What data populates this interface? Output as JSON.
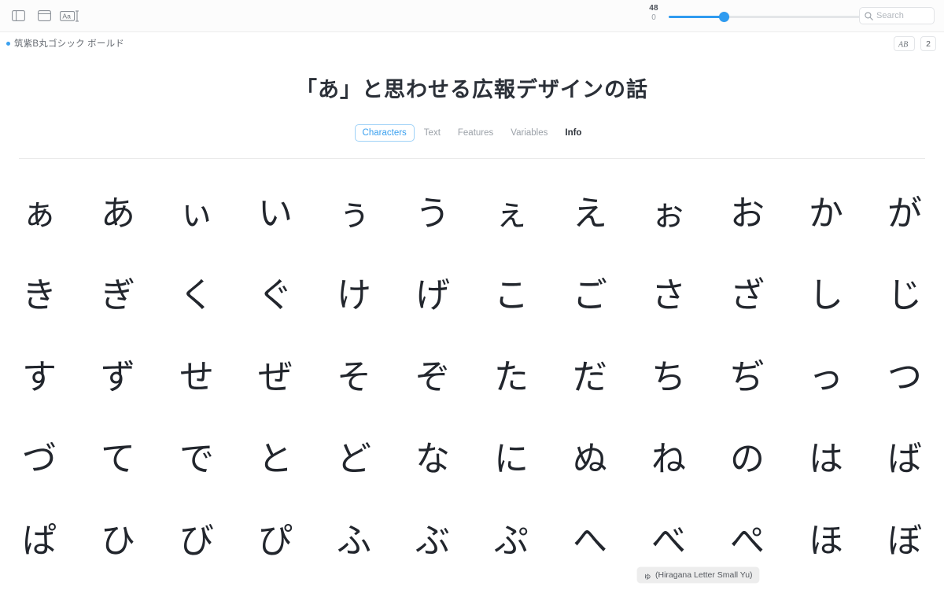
{
  "toolbar": {
    "icons": [
      {
        "name": "sidebar-toggle-icon",
        "label": "Sidebar"
      },
      {
        "name": "panel-toggle-icon",
        "label": "Panel"
      },
      {
        "name": "text-tool-icon",
        "label": "Aa"
      }
    ],
    "size_slider": {
      "value": "48",
      "min": "0",
      "fill_percent": 28
    },
    "search": {
      "placeholder": "Search",
      "value": "",
      "icon": "search-icon"
    }
  },
  "fontbar": {
    "status_dot_color": "#3aa0ef",
    "font_name": "筑紫B丸ゴシック ボールド",
    "ligature_chip": "AB",
    "count_chip": "2"
  },
  "specimen": {
    "title": "「あ」と思わせる広報デザインの話"
  },
  "tabs": [
    {
      "label": "Characters",
      "state": "selected"
    },
    {
      "label": "Text",
      "state": "normal"
    },
    {
      "label": "Features",
      "state": "normal"
    },
    {
      "label": "Variables",
      "state": "normal"
    },
    {
      "label": "Info",
      "state": "strong"
    }
  ],
  "glyphs": [
    "ぁ",
    "あ",
    "ぃ",
    "い",
    "ぅ",
    "う",
    "ぇ",
    "え",
    "ぉ",
    "お",
    "か",
    "が",
    "き",
    "ぎ",
    "く",
    "ぐ",
    "け",
    "げ",
    "こ",
    "ご",
    "さ",
    "ざ",
    "し",
    "じ",
    "す",
    "ず",
    "せ",
    "ぜ",
    "そ",
    "ぞ",
    "た",
    "だ",
    "ち",
    "ぢ",
    "っ",
    "つ",
    "づ",
    "て",
    "で",
    "と",
    "ど",
    "な",
    "に",
    "ぬ",
    "ね",
    "の",
    "は",
    "ば",
    "ぱ",
    "ひ",
    "び",
    "ぴ",
    "ふ",
    "ぶ",
    "ぷ",
    "へ",
    "べ",
    "ぺ",
    "ほ",
    "ぼ"
  ],
  "tooltip": {
    "glyph": "ゅ",
    "text": "(Hiragana Letter Small Yu)"
  },
  "colors": {
    "accent": "#3aa0ef",
    "slider_fill": "#2f9bf0",
    "glyph_ink": "#22262d",
    "muted_text": "#9ba1a8",
    "border": "#e3e5e8"
  }
}
